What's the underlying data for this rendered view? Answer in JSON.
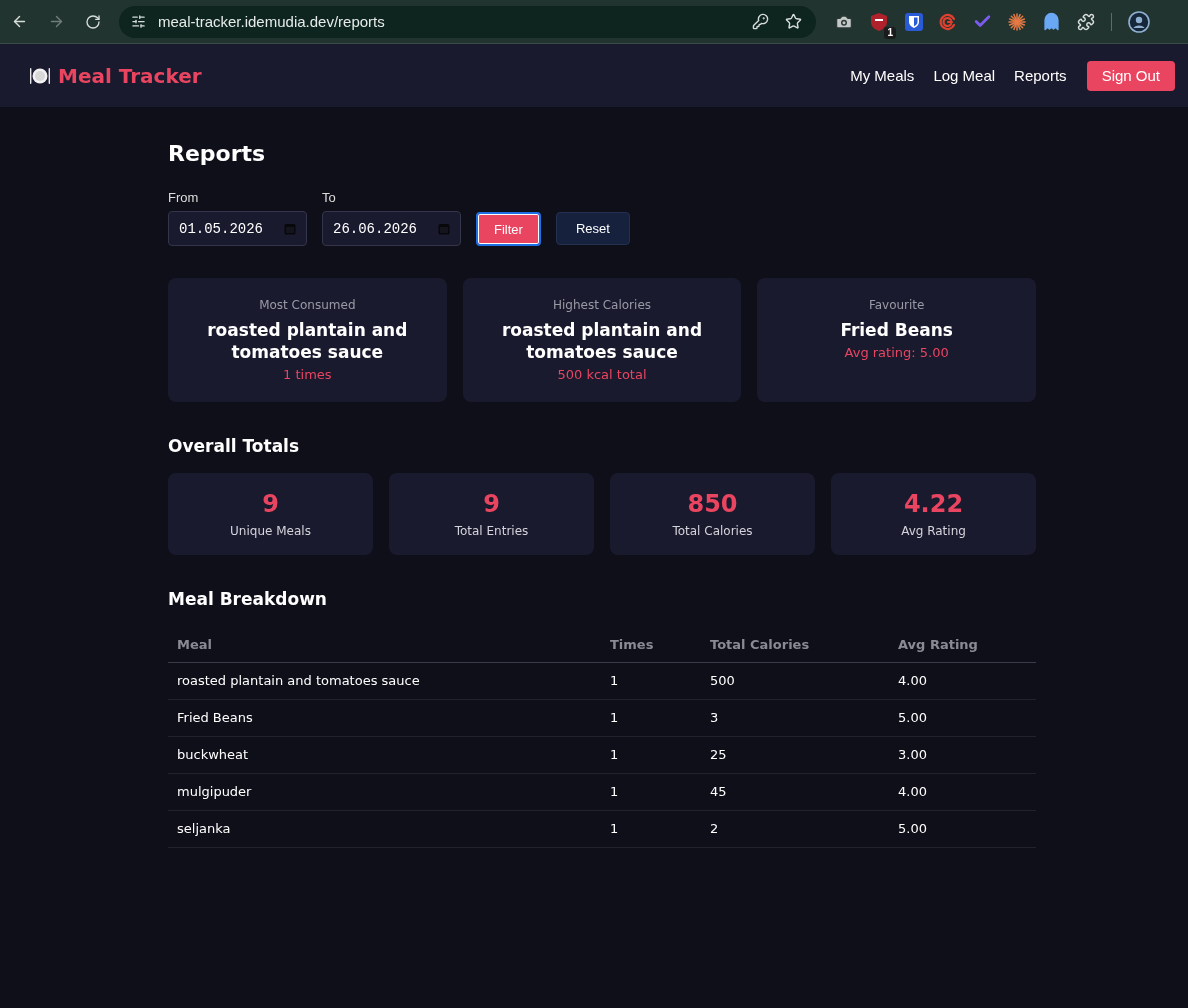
{
  "browser": {
    "url": "meal-tracker.idemudia.dev/reports",
    "back_disabled": false,
    "forward_disabled": true,
    "extension_badge": "1"
  },
  "navbar": {
    "logo": "Meal Tracker",
    "links": [
      "My Meals",
      "Log Meal",
      "Reports"
    ],
    "sign_out": "Sign Out"
  },
  "title": "Reports",
  "filter": {
    "fields": [
      {
        "label": "From",
        "value": "01.05.2026"
      },
      {
        "label": "To",
        "value": "26.06.2026"
      }
    ],
    "buttons": [
      {
        "label": "Filter",
        "kind": "primary",
        "focused": true
      },
      {
        "label": "Reset",
        "kind": "secondary",
        "focused": false
      }
    ]
  },
  "highlights": [
    {
      "label": "Most Consumed",
      "value": "roasted plantain and tomatoes sauce",
      "detail": "1 times"
    },
    {
      "label": "Highest Calories",
      "value": "roasted plantain and tomatoes sauce",
      "detail": "500 kcal total"
    },
    {
      "label": "Favourite",
      "value": "Fried Beans",
      "detail": "Avg rating: 5.00"
    }
  ],
  "totals": {
    "title": "Overall Totals",
    "stats": [
      {
        "value": "9",
        "label": "Unique Meals"
      },
      {
        "value": "9",
        "label": "Total Entries"
      },
      {
        "value": "850",
        "label": "Total Calories"
      },
      {
        "value": "4.22",
        "label": "Avg Rating"
      }
    ]
  },
  "breakdown": {
    "title": "Meal Breakdown",
    "columns": [
      "Meal",
      "Times",
      "Total Calories",
      "Avg Rating"
    ],
    "rows": [
      [
        "roasted plantain and tomatoes sauce",
        "1",
        "500",
        "4.00"
      ],
      [
        "Fried Beans",
        "1",
        "3",
        "5.00"
      ],
      [
        "buckwheat",
        "1",
        "25",
        "3.00"
      ],
      [
        "mulgipuder",
        "1",
        "45",
        "4.00"
      ],
      [
        "seljanka",
        "1",
        "2",
        "5.00"
      ]
    ]
  }
}
